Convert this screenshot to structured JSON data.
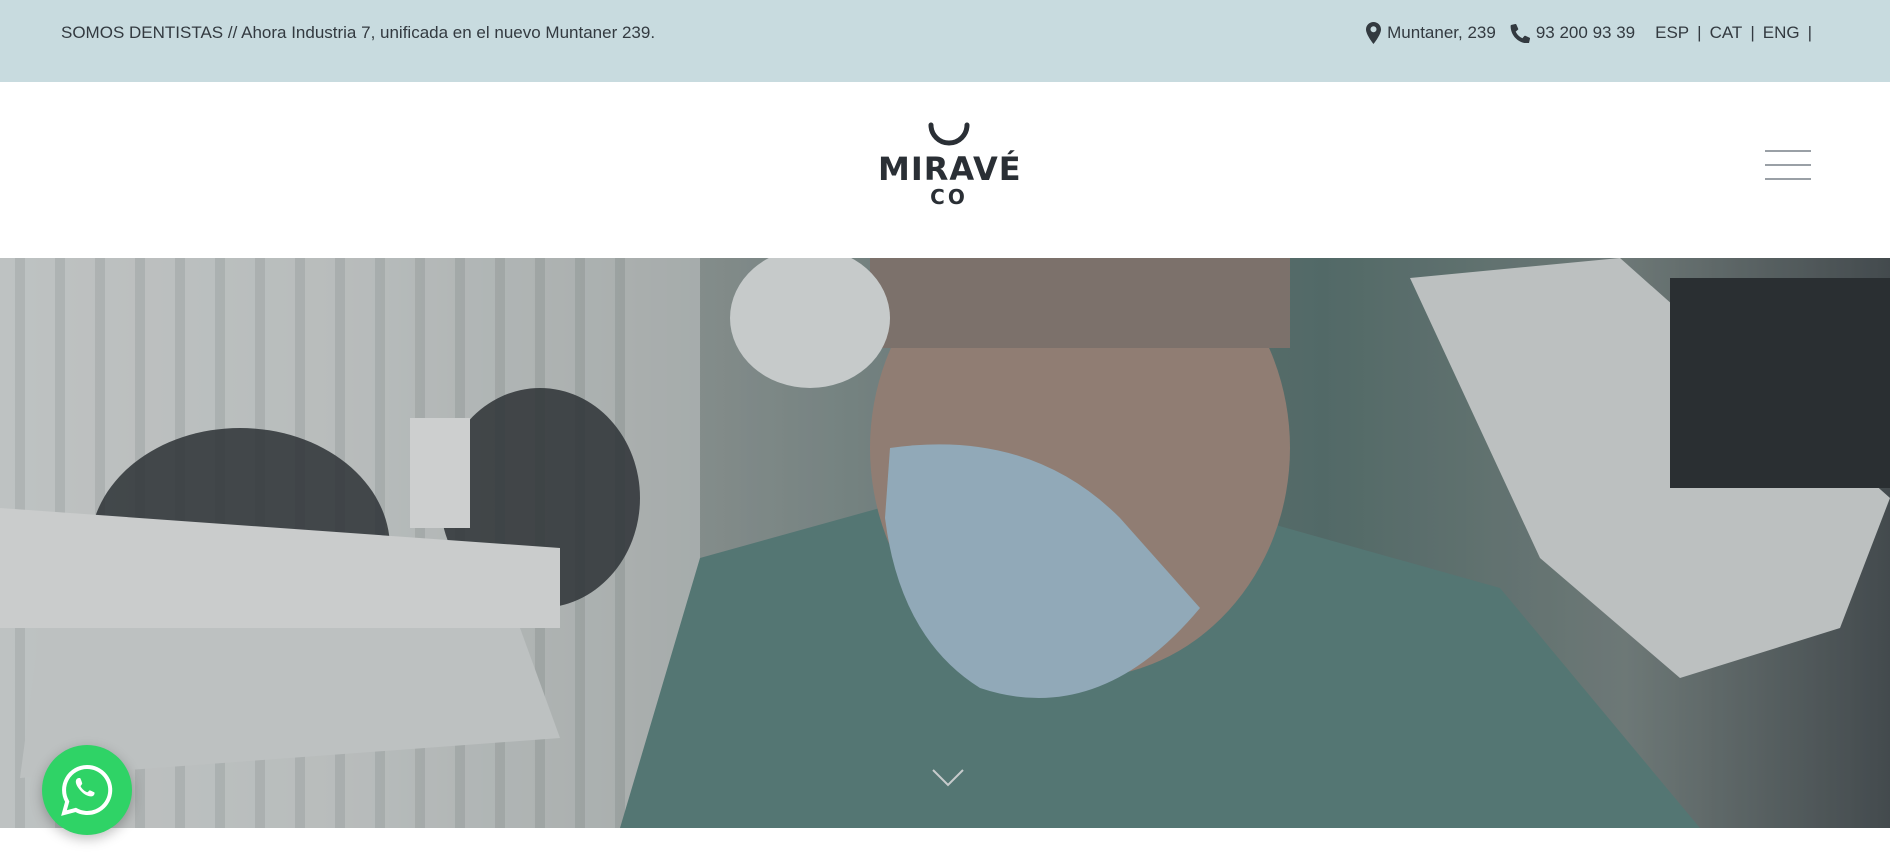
{
  "topbar": {
    "message": "SOMOS DENTISTAS // Ahora Industria 7, unificada en el nuevo Muntaner 239.",
    "address": "Muntaner, 239",
    "phone": "93 200 93 39",
    "languages": [
      "ESP",
      "CAT",
      "ENG"
    ],
    "separator": "|"
  },
  "header": {
    "logo_name": "MIRAVÉ",
    "logo_sub": "CO"
  },
  "icons": {
    "address": "map-pin-icon",
    "phone": "phone-icon",
    "menu": "hamburger-menu-icon",
    "scroll": "chevron-down-icon",
    "chat": "whatsapp-icon"
  },
  "colors": {
    "topbar_bg": "#c8dbdf",
    "text_dark": "#2a2f35",
    "whatsapp_green": "#2fd366"
  }
}
